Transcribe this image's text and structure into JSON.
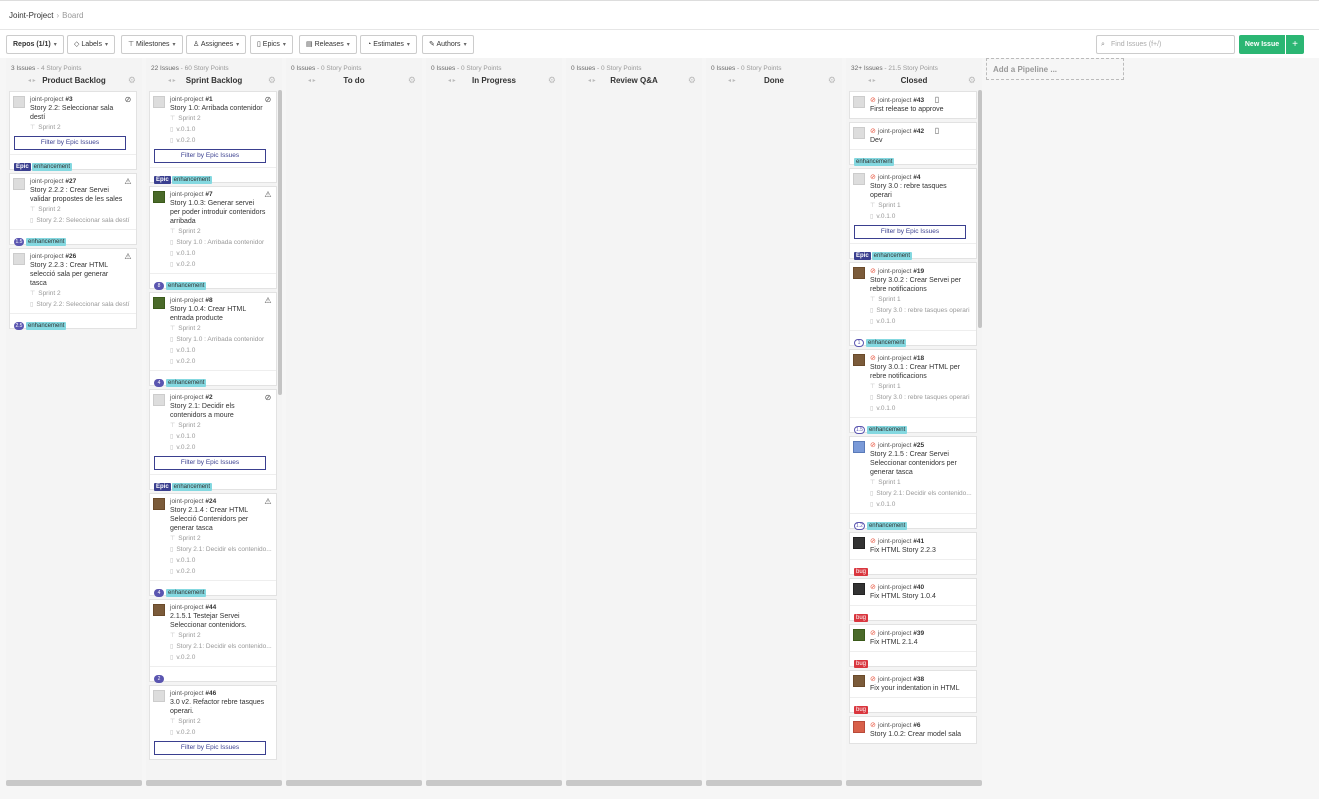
{
  "breadcrumb": {
    "project": "Joint-Project",
    "sep": "›",
    "page": "Board"
  },
  "toolbar": {
    "repos": "Repos (1/1)",
    "labels": "Labels",
    "milestones": "Milestones",
    "assignees": "Assignees",
    "epics": "Epics",
    "releases": "Releases",
    "estimates": "Estimates",
    "authors": "Authors",
    "search_placeholder": "Find Issues (f+/)",
    "new_issue": "New Issue",
    "plus": "+"
  },
  "labels": {
    "epic": "Epic",
    "enh": "enhancement",
    "bug": "bug",
    "filter": "Filter by Epic Issues"
  },
  "add_pipeline": "Add a Pipeline ...",
  "pipelines": [
    {
      "count": "3 Issues",
      "points": " - 4 Story Points",
      "title": "Product Backlog"
    },
    {
      "count": "22 Issues",
      "points": " - 60 Story Points",
      "title": "Sprint Backlog"
    },
    {
      "count": "0 Issues",
      "points": " - 0 Story Points",
      "title": "To do"
    },
    {
      "count": "0 Issues",
      "points": " - 0 Story Points",
      "title": "In Progress"
    },
    {
      "count": "0 Issues",
      "points": " - 0 Story Points",
      "title": "Review Q&A"
    },
    {
      "count": "0 Issues",
      "points": " - 0 Story Points",
      "title": "Done"
    },
    {
      "count": "32+ Issues",
      "points": " - 21.5 Story Points",
      "title": "Closed"
    }
  ],
  "cards": {
    "pb": [
      {
        "repo": "joint-project ",
        "num": "#3",
        "title": "Story 2.2: Seleccionar sala destí",
        "m1": "Sprint 2",
        "filter": true,
        "epic": true,
        "est": ""
      },
      {
        "repo": "joint-project ",
        "num": "#27",
        "title": "Story 2.2.2 : Crear Servei validar propostes de les sales",
        "m1": "Sprint 2",
        "m2": "Story 2.2: Seleccionar sala destí",
        "est": "1.5"
      },
      {
        "repo": "joint-project ",
        "num": "#26",
        "title": "Story 2.2.3 : Crear HTML selecció sala per generar tasca",
        "m1": "Sprint 2",
        "m2": "Story 2.2: Seleccionar sala destí",
        "est": "2.5"
      }
    ],
    "sb": [
      {
        "repo": "joint-project ",
        "num": "#1",
        "title": "Story 1.0: Arribada contenidor",
        "m1": "Sprint 2",
        "m2": "v.0.1.0",
        "m3": "v.0.2.0"
      },
      {
        "repo": "joint-project ",
        "num": "#7",
        "title": "Story 1.0.3: Generar servei per poder introduir contenidors arribada",
        "m1": "Sprint 2",
        "m2": "Story 1.0 : Arribada contenidor",
        "m3": "v.0.1.0",
        "m4": "v.0.2.0",
        "est": "8"
      },
      {
        "repo": "joint-project ",
        "num": "#8",
        "title": "Story 1.0.4: Crear HTML entrada producte",
        "m1": "Sprint 2",
        "m2": "Story 1.0 : Arribada contenidor",
        "m3": "v.0.1.0",
        "m4": "v.0.2.0",
        "est": "4"
      },
      {
        "repo": "joint-project ",
        "num": "#2",
        "title": "Story 2.1: Decidir els contenidors a moure",
        "m1": "Sprint 2",
        "m2": "v.0.1.0",
        "m3": "v.0.2.0"
      },
      {
        "repo": "joint-project ",
        "num": "#24",
        "title": "Story 2.1.4 : Crear HTML Selecció Contenidors per generar tasca",
        "m1": "Sprint 2",
        "m2": "Story 2.1: Decidir els contenido...",
        "m3": "v.0.1.0",
        "m4": "v.0.2.0",
        "est": "4"
      },
      {
        "repo": "joint-project ",
        "num": "#44",
        "title": "2.1.5.1 Testejar Servei Seleccionar contenidors.",
        "m1": "Sprint 2",
        "m2": "Story 2.1: Decidir els contenido...",
        "m3": "v.0.2.0",
        "est": "2"
      },
      {
        "repo": "joint-project ",
        "num": "#46",
        "title": "3.0 v2. Refactor rebre tasques operari.",
        "m1": "Sprint 2",
        "m2": "v.0.2.0"
      }
    ],
    "cl": [
      {
        "repo": "joint-project ",
        "num": "#43",
        "title": "First release to approve"
      },
      {
        "repo": "joint-project ",
        "num": "#42",
        "title": "Dev"
      },
      {
        "repo": "joint-project ",
        "num": "#4",
        "title": "Story 3.0 : rebre tasques operari",
        "m1": "Sprint 1",
        "m2": "v.0.1.0"
      },
      {
        "repo": "joint-project ",
        "num": "#19",
        "title": "Story 3.0.2 : Crear Servei per rebre notificacions",
        "m1": "Sprint 1",
        "m2": "Story 3.0 : rebre tasques operari",
        "m3": "v.0.1.0",
        "est": "1"
      },
      {
        "repo": "joint-project ",
        "num": "#18",
        "title": "Story 3.0.1 : Crear HTML per rebre notificacions",
        "m1": "Sprint 1",
        "m2": "Story 3.0 : rebre tasques operari",
        "m3": "v.0.1.0",
        "est": "1.5"
      },
      {
        "repo": "joint-project ",
        "num": "#25",
        "title": "Story 2.1.5 : Crear Servei Seleccionar contenidors per generar tasca",
        "m1": "Sprint 1",
        "m2": "Story 2.1: Decidir els contenido...",
        "m3": "v.0.1.0",
        "est": "1.2"
      },
      {
        "repo": "joint-project ",
        "num": "#41",
        "title": "Fix HTML Story 2.2.3"
      },
      {
        "repo": "joint-project ",
        "num": "#40",
        "title": "Fix HTML Story 1.0.4"
      },
      {
        "repo": "joint-project ",
        "num": "#39",
        "title": "Fix HTML 2.1.4"
      },
      {
        "repo": "joint-project ",
        "num": "#38",
        "title": "Fix your indentation in HTML"
      },
      {
        "repo": "joint-project ",
        "num": "#6",
        "title": "Story 1.0.2: Crear model sala"
      }
    ]
  }
}
